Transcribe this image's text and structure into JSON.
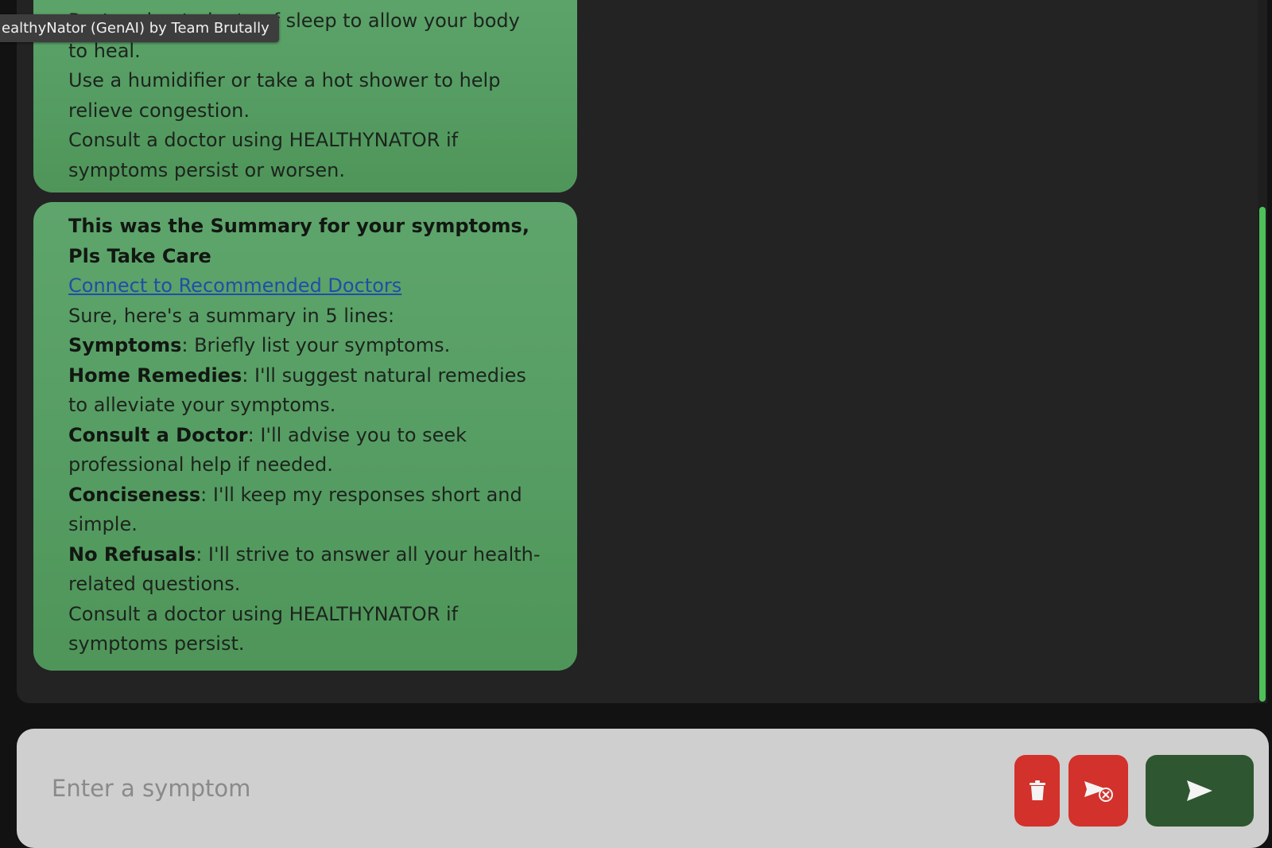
{
  "app": {
    "tooltip": "ealthyNator (GenAI) by Team Brutally"
  },
  "chat": {
    "message1": {
      "lines": [
        "Rest and get plenty of sleep to allow your body to heal.",
        "Use a humidifier or take a hot shower to help relieve congestion.",
        "Consult a doctor using HEALTHYNATOR if symptoms persist or worsen."
      ]
    },
    "message2": {
      "heading": "This was the Summary for your symptoms, Pls Take Care",
      "link": "Connect to Recommended Doctors",
      "intro": "Sure, here's a summary in 5 lines:",
      "items": [
        {
          "label": "Symptoms",
          "text": ": Briefly list your symptoms."
        },
        {
          "label": "Home Remedies",
          "text": ": I'll suggest natural remedies to alleviate your symptoms."
        },
        {
          "label": "Consult a Doctor",
          "text": ": I'll advise you to seek professional help if needed."
        },
        {
          "label": "Conciseness",
          "text": ": I'll keep my responses short and simple."
        },
        {
          "label": "No Refusals",
          "text": ": I'll strive to answer all your health-related questions."
        }
      ],
      "footer": "Consult a doctor using HEALTHYNATOR if symptoms persist."
    }
  },
  "input": {
    "placeholder": "Enter a symptom"
  },
  "icons": {
    "trash": "trash-icon",
    "cancel": "send-cancel-icon",
    "send": "send-icon"
  },
  "colors": {
    "bubble": "#5a9f66",
    "danger": "#d3312b",
    "send": "#2e5630",
    "link": "#1e4fa8",
    "scrollbar": "#4fbf5a"
  }
}
